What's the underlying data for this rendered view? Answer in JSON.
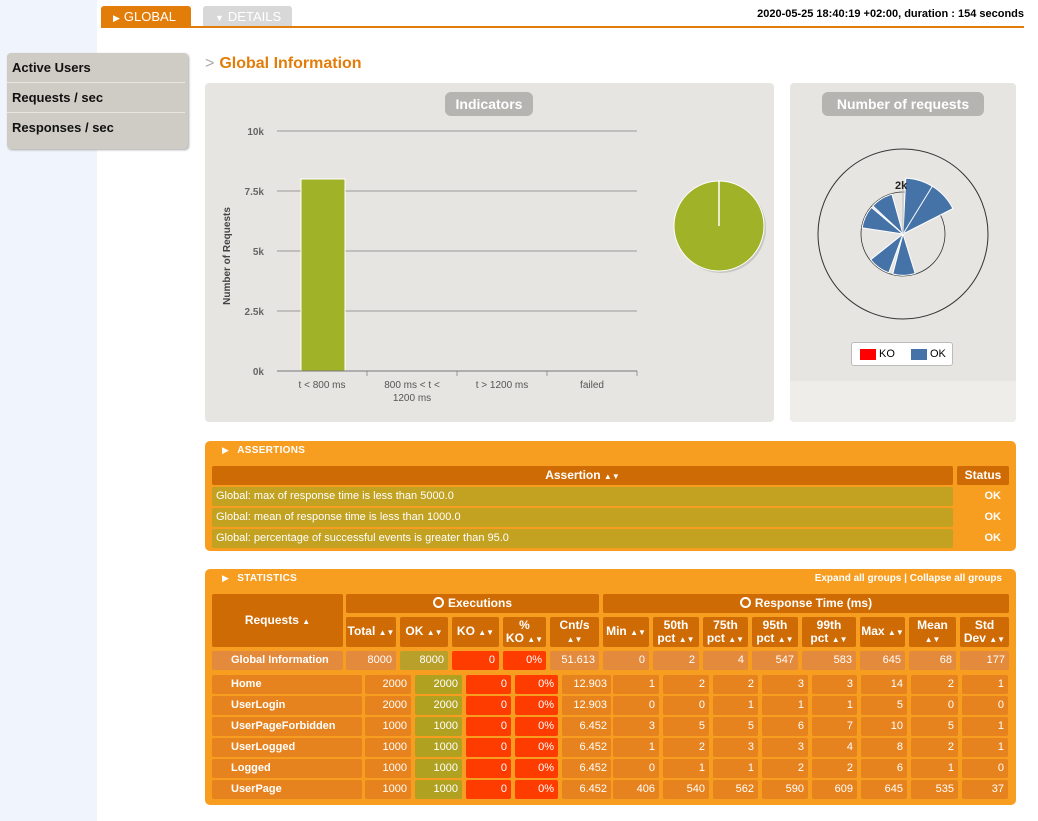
{
  "tabs": {
    "global": "GLOBAL",
    "details": "DETAILS"
  },
  "run_info": "2020-05-25 18:40:19 +02:00, duration : 154 seconds",
  "sidebar": {
    "items": [
      {
        "label": "Active Users"
      },
      {
        "label": "Requests / sec"
      },
      {
        "label": "Responses / sec"
      }
    ]
  },
  "section_title": "Global Information",
  "indicators": {
    "title": "Indicators",
    "chart_data": {
      "type": "bar",
      "categories": [
        "t < 800 ms",
        "800 ms < t < 1200 ms",
        "t > 1200 ms",
        "failed"
      ],
      "category_lines": [
        [
          "t < 800 ms"
        ],
        [
          "800 ms < t <",
          "1200 ms"
        ],
        [
          "t > 1200 ms"
        ],
        [
          "failed"
        ]
      ],
      "values": [
        8000,
        0,
        0,
        0
      ],
      "ylabel": "Number of Requests",
      "ylim": [
        0,
        10000
      ],
      "yticks": [
        {
          "v": 0,
          "label": "0k"
        },
        {
          "v": 2500,
          "label": "2.5k"
        },
        {
          "v": 5000,
          "label": "5k"
        },
        {
          "v": 7500,
          "label": "7.5k"
        },
        {
          "v": 10000,
          "label": "10k"
        }
      ],
      "bar_color": "#a0b228",
      "pie": {
        "type": "pie",
        "values": [
          8000,
          0,
          0,
          0
        ],
        "colors": [
          "#a0b228",
          "#ffdd00",
          "#ff9916",
          "#ff0000"
        ]
      }
    }
  },
  "number_of_requests": {
    "title": "Number of requests",
    "radial_label": "2k",
    "chart_data": {
      "type": "bar",
      "polar": true,
      "categories": [
        "Home",
        "UserLogin",
        "UserPageForbidden",
        "UserLogged",
        "Logged",
        "UserPage"
      ],
      "series": [
        {
          "name": "OK",
          "values": [
            2000,
            2000,
            1000,
            1000,
            1000,
            1000
          ]
        },
        {
          "name": "KO",
          "values": [
            0,
            0,
            0,
            0,
            0,
            0
          ]
        }
      ],
      "colors": {
        "OK": "#4572a7",
        "KO": "#ff0000"
      }
    },
    "legend": [
      {
        "label": "KO",
        "color": "#ff0000"
      },
      {
        "label": "OK",
        "color": "#4572a7"
      }
    ]
  },
  "assertions": {
    "header": "ASSERTIONS",
    "col_assertion": "Assertion",
    "col_status": "Status",
    "rows": [
      {
        "text": "Global: max of response time is less than 5000.0",
        "status": "OK"
      },
      {
        "text": "Global: mean of response time is less than 1000.0",
        "status": "OK"
      },
      {
        "text": "Global: percentage of successful events is greater than 95.0",
        "status": "OK"
      }
    ]
  },
  "statistics": {
    "header": "STATISTICS",
    "expand": "Expand all groups",
    "sep": "|",
    "collapse": "Collapse all groups",
    "requests_col": "Requests",
    "executions": "Executions",
    "response_time": "Response Time (ms)",
    "cols": [
      "Total",
      "OK",
      "KO",
      "% KO",
      "Cnt/s",
      "Min",
      "50th pct",
      "75th pct",
      "95th pct",
      "99th pct",
      "Max",
      "Mean",
      "Std Dev"
    ],
    "global_row": {
      "name": "Global Information",
      "values": [
        "8000",
        "8000",
        "0",
        "0%",
        "51.613",
        "0",
        "2",
        "4",
        "547",
        "583",
        "645",
        "68",
        "177"
      ]
    },
    "rows": [
      {
        "name": "Home",
        "values": [
          "2000",
          "2000",
          "0",
          "0%",
          "12.903",
          "1",
          "2",
          "2",
          "3",
          "3",
          "14",
          "2",
          "1"
        ]
      },
      {
        "name": "UserLogin",
        "values": [
          "2000",
          "2000",
          "0",
          "0%",
          "12.903",
          "0",
          "0",
          "1",
          "1",
          "1",
          "5",
          "0",
          "0"
        ]
      },
      {
        "name": "UserPageForbidden",
        "values": [
          "1000",
          "1000",
          "0",
          "0%",
          "6.452",
          "3",
          "5",
          "5",
          "6",
          "7",
          "10",
          "5",
          "1"
        ]
      },
      {
        "name": "UserLogged",
        "values": [
          "1000",
          "1000",
          "0",
          "0%",
          "6.452",
          "1",
          "2",
          "3",
          "3",
          "4",
          "8",
          "2",
          "1"
        ]
      },
      {
        "name": "Logged",
        "values": [
          "1000",
          "1000",
          "0",
          "0%",
          "6.452",
          "0",
          "1",
          "1",
          "2",
          "2",
          "6",
          "1",
          "0"
        ]
      },
      {
        "name": "UserPage",
        "values": [
          "1000",
          "1000",
          "0",
          "0%",
          "6.452",
          "406",
          "540",
          "562",
          "590",
          "609",
          "645",
          "535",
          "37"
        ]
      }
    ]
  }
}
